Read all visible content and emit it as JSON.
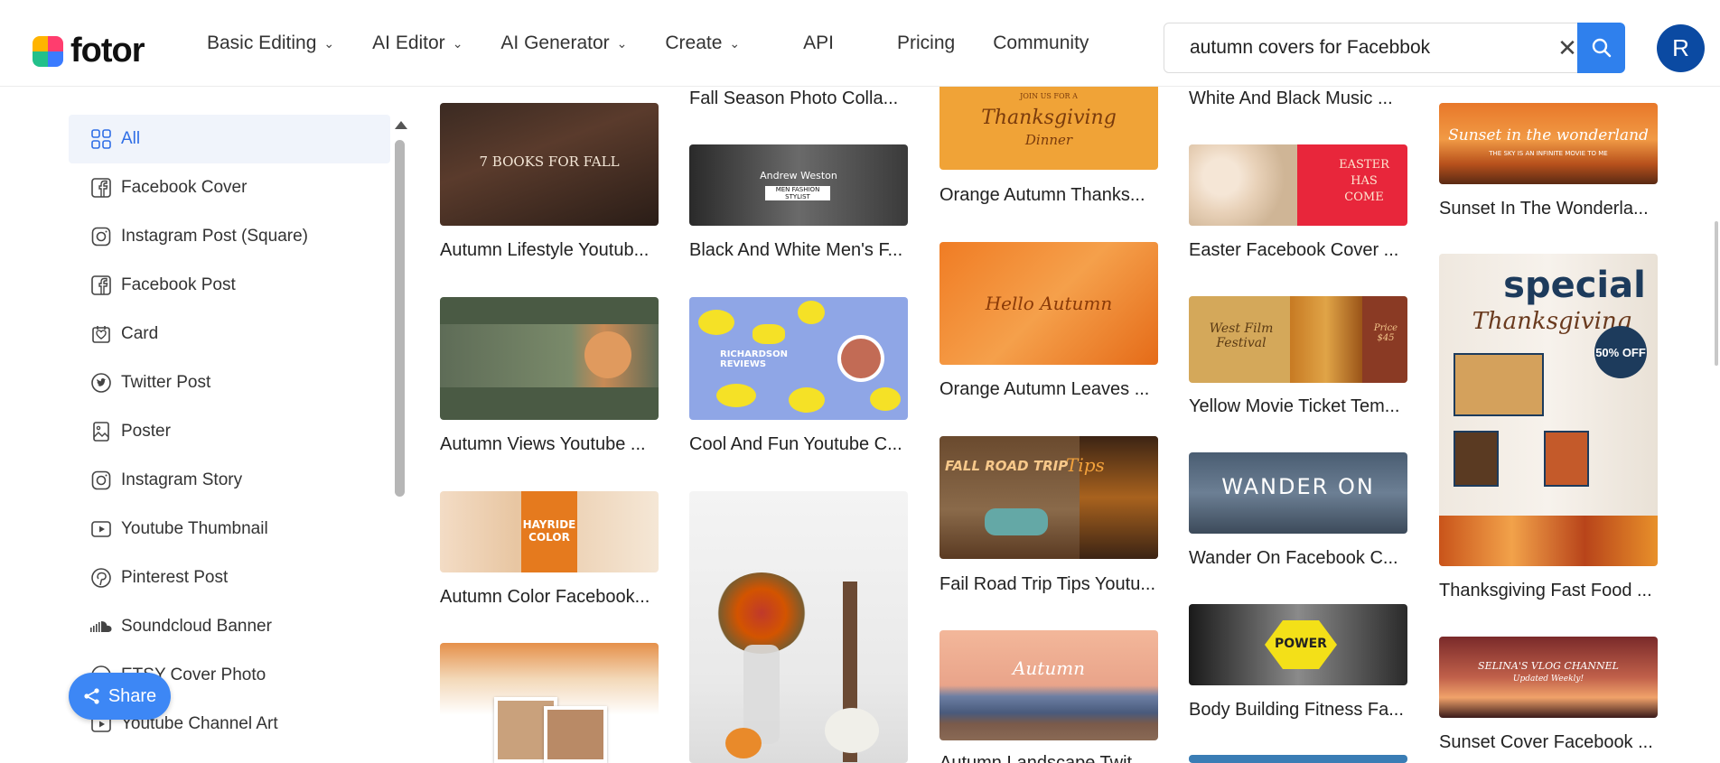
{
  "header": {
    "logo_text": "fotor",
    "nav": [
      {
        "label": "Basic Editing",
        "dropdown": true
      },
      {
        "label": "AI Editor",
        "dropdown": true
      },
      {
        "label": "AI Generator",
        "dropdown": true
      },
      {
        "label": "Create",
        "dropdown": true
      },
      {
        "label": "API",
        "dropdown": false
      },
      {
        "label": "Pricing",
        "dropdown": false
      },
      {
        "label": "Community",
        "dropdown": false
      }
    ],
    "search_value": "autumn covers for Facebbok",
    "avatar_initial": "R"
  },
  "sidebar": {
    "items": [
      {
        "label": "All",
        "icon": "grid-icon"
      },
      {
        "label": "Facebook Cover",
        "icon": "facebook-icon"
      },
      {
        "label": "Instagram Post (Square)",
        "icon": "instagram-icon"
      },
      {
        "label": "Facebook Post",
        "icon": "facebook-icon"
      },
      {
        "label": "Card",
        "icon": "card-icon"
      },
      {
        "label": "Twitter Post",
        "icon": "twitter-icon"
      },
      {
        "label": "Poster",
        "icon": "poster-icon"
      },
      {
        "label": "Instagram Story",
        "icon": "instagram-icon"
      },
      {
        "label": "Youtube Thumbnail",
        "icon": "youtube-icon"
      },
      {
        "label": "Pinterest Post",
        "icon": "pinterest-icon"
      },
      {
        "label": "Soundcloud Banner",
        "icon": "soundcloud-icon"
      },
      {
        "label": "ETSY Cover Photo",
        "icon": "etsy-icon"
      },
      {
        "label": "Youtube Channel Art",
        "icon": "youtube-icon"
      }
    ]
  },
  "share_label": "Share",
  "templates": [
    {
      "title": "Autumn Lifestyle Youtub...",
      "thumb_text": "7 BOOKS FOR FALL"
    },
    {
      "title": "Autumn Views Youtube ...",
      "thumb_text": ""
    },
    {
      "title": "Autumn Color Facebook...",
      "thumb_text": "HAYRIDE COLOR"
    },
    {
      "title": "Fall Season Photo Colla..."
    },
    {
      "title": "Black And White Men's F...",
      "thumb_text": "Andrew Weston",
      "thumb_sub": "MEN FASHION STYLIST"
    },
    {
      "title": "Cool And Fun Youtube C...",
      "thumb_text": "RICHARDSON REVIEWS"
    },
    {
      "title": "Orange Autumn Thanks...",
      "thumb_text": "Thanksgiving",
      "thumb_sub": "Dinner",
      "thumb_top": "JOIN US FOR A"
    },
    {
      "title": "Orange Autumn Leaves ...",
      "thumb_text": "Hello Autumn"
    },
    {
      "title": "Fail Road Trip Tips Youtu...",
      "thumb_text": "FALL ROAD TRIP",
      "thumb_sub": "Tips"
    },
    {
      "title": "Autumn Landscape Twit...",
      "thumb_text": "Autumn"
    },
    {
      "title": "White And Black Music ..."
    },
    {
      "title": "Easter Facebook Cover ...",
      "thumb_text": "EASTER HAS COME"
    },
    {
      "title": "Yellow Movie Ticket Tem...",
      "thumb_text": "West Film Festival",
      "thumb_sub": "Price $45"
    },
    {
      "title": "Wander On Facebook C...",
      "thumb_text": "WANDER ON"
    },
    {
      "title": "Body Building Fitness Fa...",
      "thumb_text": "POWER"
    },
    {
      "title": "Sunset In The Wonderla...",
      "thumb_text": "Sunset in the wonderland",
      "thumb_sub": "THE SKY IS AN INFINITE MOVIE TO ME"
    },
    {
      "title": "Thanksgiving Fast Food ...",
      "thumb_text": "special",
      "thumb_sub": "Thanksgiving",
      "thumb_badge": "50% OFF"
    },
    {
      "title": "Sunset Cover Facebook ...",
      "thumb_text": "SELINA'S VLOG CHANNEL",
      "thumb_sub": "Updated Weekly!"
    }
  ]
}
